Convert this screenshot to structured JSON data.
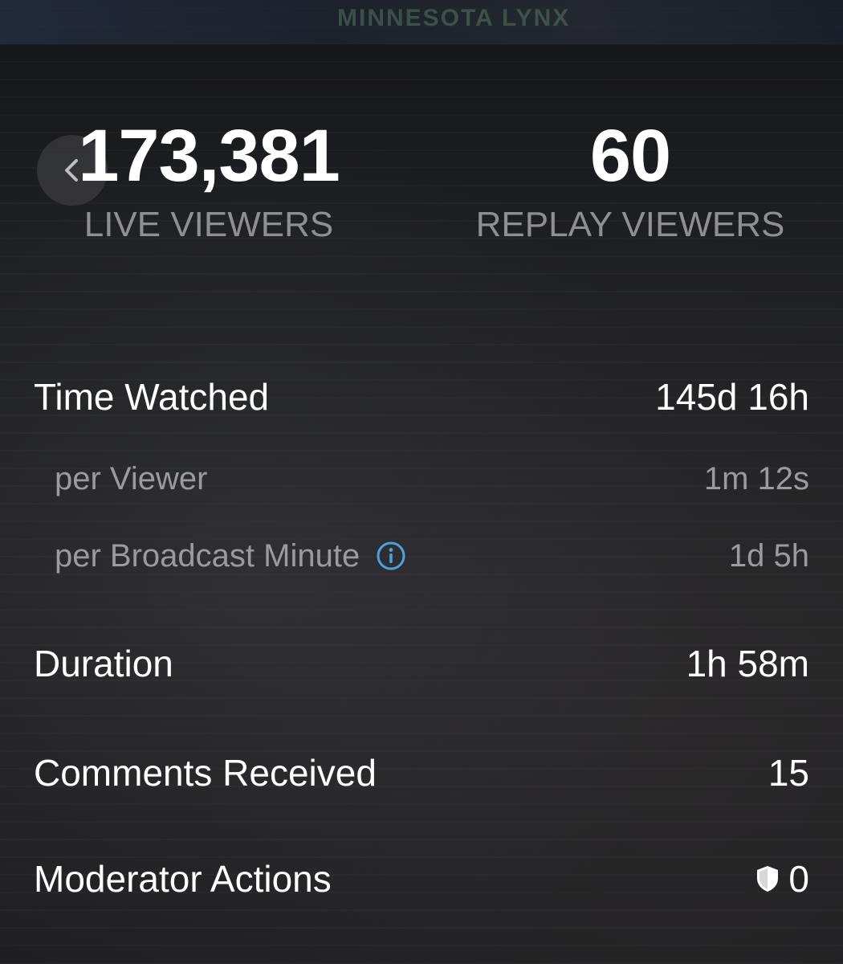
{
  "background": {
    "banner_text": "MINNESOTA LYNX"
  },
  "header": {
    "back_icon": "chevron-left-icon"
  },
  "stats": {
    "live_viewers": {
      "value": "173,381",
      "label": "LIVE VIEWERS"
    },
    "replay_viewers": {
      "value": "60",
      "label": "REPLAY VIEWERS"
    }
  },
  "metrics": {
    "time_watched": {
      "label": "Time Watched",
      "value": "145d 16h"
    },
    "per_viewer": {
      "label": "per Viewer",
      "value": "1m 12s"
    },
    "per_broadcast_minute": {
      "label": "per Broadcast Minute",
      "value": "1d 5h",
      "icon": "info-icon"
    },
    "duration": {
      "label": "Duration",
      "value": "1h 58m"
    },
    "comments_received": {
      "label": "Comments Received",
      "value": "15"
    },
    "moderator_actions": {
      "label": "Moderator Actions",
      "value": "0",
      "icon": "shield-icon"
    }
  },
  "colors": {
    "primary_text": "#ffffff",
    "secondary_text": "#8e8e93",
    "info_accent": "#4aa3df"
  }
}
